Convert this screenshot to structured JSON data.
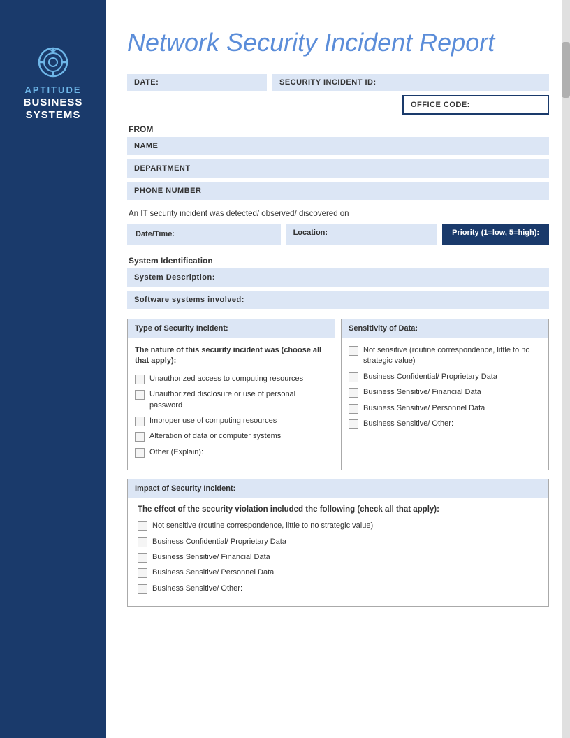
{
  "sidebar": {
    "icon_label": "target-icon",
    "brand_top": "APTITUDE",
    "brand_bottom": "BUSINESS\nSYSTEMS"
  },
  "header": {
    "title": "Network Security Incident Report"
  },
  "form": {
    "date_label": "DATE:",
    "incident_id_label": "SECURITY INCIDENT ID:",
    "office_code_label": "OFFICE CODE:",
    "from_label": "FROM",
    "name_label": "NAME",
    "department_label": "DEPARTMENT",
    "phone_label": "PHONE NUMBER",
    "it_security_text": "An IT security incident was detected/ observed/ discovered on",
    "datetime_label": "Date/Time:",
    "location_label": "Location:",
    "priority_label": "Priority (1=low, 5=high):",
    "system_identification": "System Identification",
    "system_description_label": "System Description:",
    "software_systems_label": "Software systems involved:",
    "type_of_incident_header": "Type of Security Incident:",
    "type_subtitle": "The nature of this security incident was (choose all that apply):",
    "type_checkboxes": [
      "Unauthorized access to computing resources",
      "Unauthorized disclosure or use of personal password",
      "Improper use of computing resources",
      "Alteration of data or computer systems",
      "Other (Explain):"
    ],
    "sensitivity_header": "Sensitivity of Data:",
    "sensitivity_checkboxes": [
      "Not sensitive (routine correspondence, little to no strategic value)",
      "Business Confidential/ Proprietary Data",
      "Business Sensitive/ Financial Data",
      "Business Sensitive/ Personnel Data",
      "Business Sensitive/ Other:"
    ],
    "impact_header": "Impact of Security Incident:",
    "impact_subtitle": "The effect of the security violation included the following (check all that apply):",
    "impact_checkboxes": [
      "Not sensitive (routine correspondence, little to no strategic value)",
      "Business Confidential/ Proprietary Data",
      "Business Sensitive/ Financial Data",
      "Business Sensitive/ Personnel Data",
      "Business Sensitive/ Other:"
    ]
  }
}
